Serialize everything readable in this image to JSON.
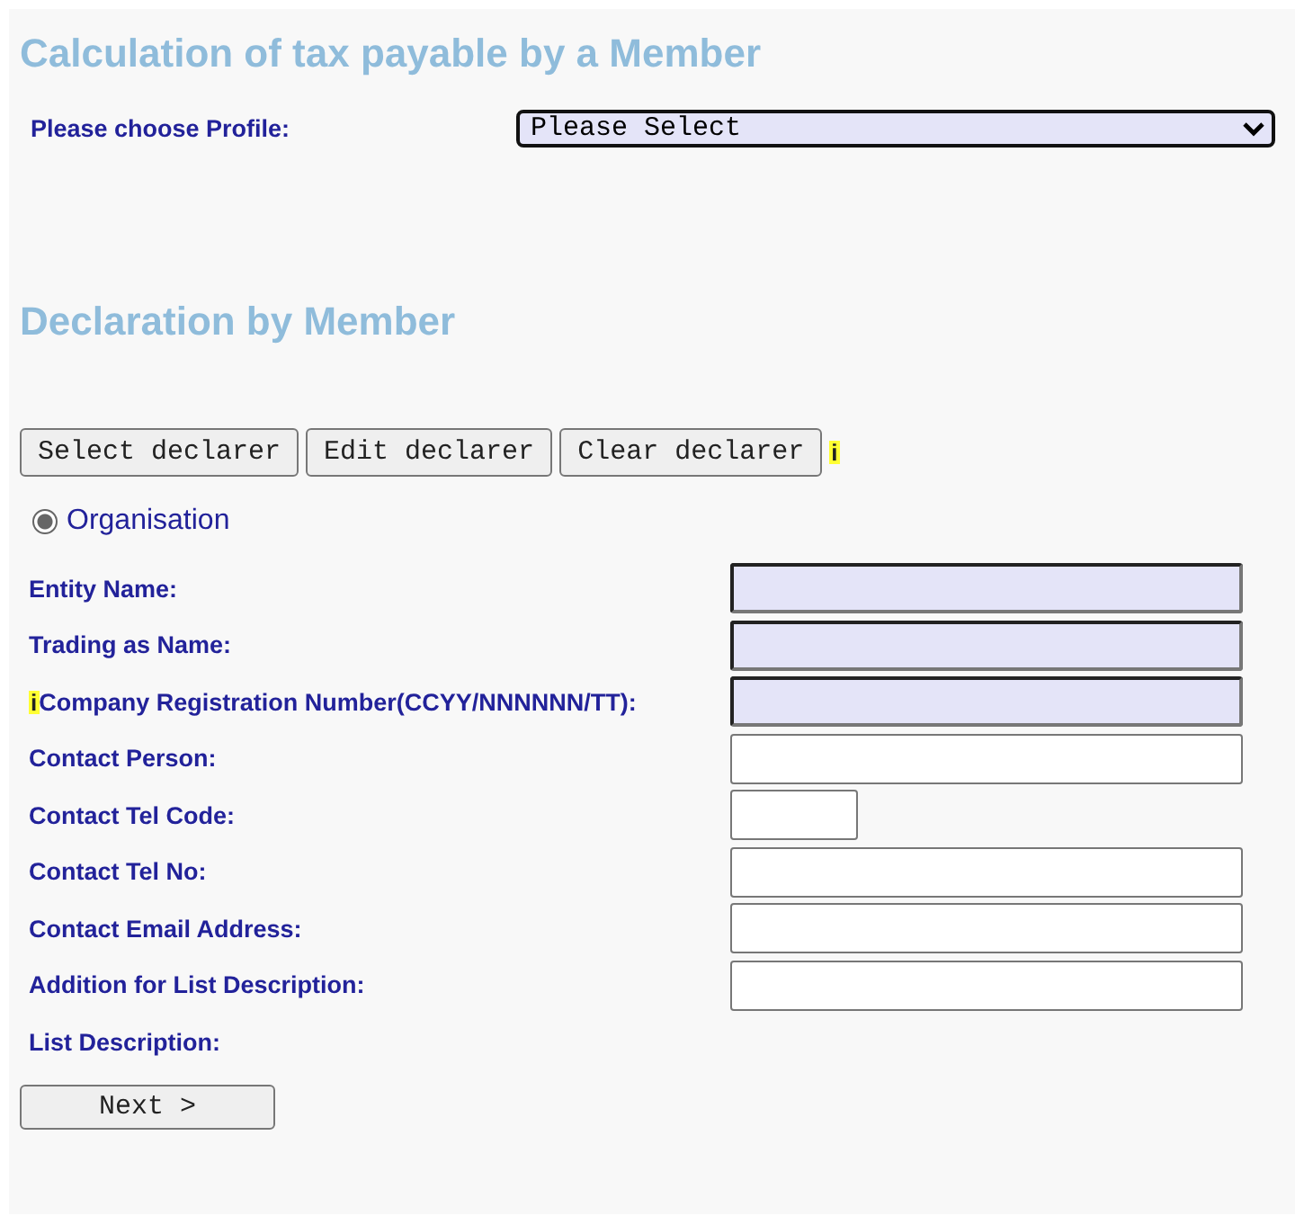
{
  "title": "Calculation of tax payable by a Member",
  "profile": {
    "label": "Please choose Profile:",
    "value": "Please Select"
  },
  "section_title": "Declaration by Member",
  "declarer_buttons": [
    "Select declarer",
    "Edit declarer",
    "Clear declarer"
  ],
  "declarer_info_mark": "i",
  "declarer_types": [
    {
      "label": "Organisation",
      "selected": true
    }
  ],
  "fields": [
    {
      "label": "Entity Name:",
      "kind": "required"
    },
    {
      "label": "Trading as Name:",
      "kind": "required"
    },
    {
      "label": "Company Registration Number(CCYY/NNNNNN/TT):",
      "kind": "required",
      "info_mark": "i"
    },
    {
      "label": "Contact Person:",
      "kind": "text"
    },
    {
      "label": "Contact Tel Code:",
      "kind": "short"
    },
    {
      "label": "Contact Tel No:",
      "kind": "text"
    },
    {
      "label": "Contact Email Address:",
      "kind": "text"
    },
    {
      "label": "Addition for List Description:",
      "kind": "text"
    },
    {
      "label": "List Description:",
      "kind": "none"
    }
  ],
  "next_button": "Next >"
}
